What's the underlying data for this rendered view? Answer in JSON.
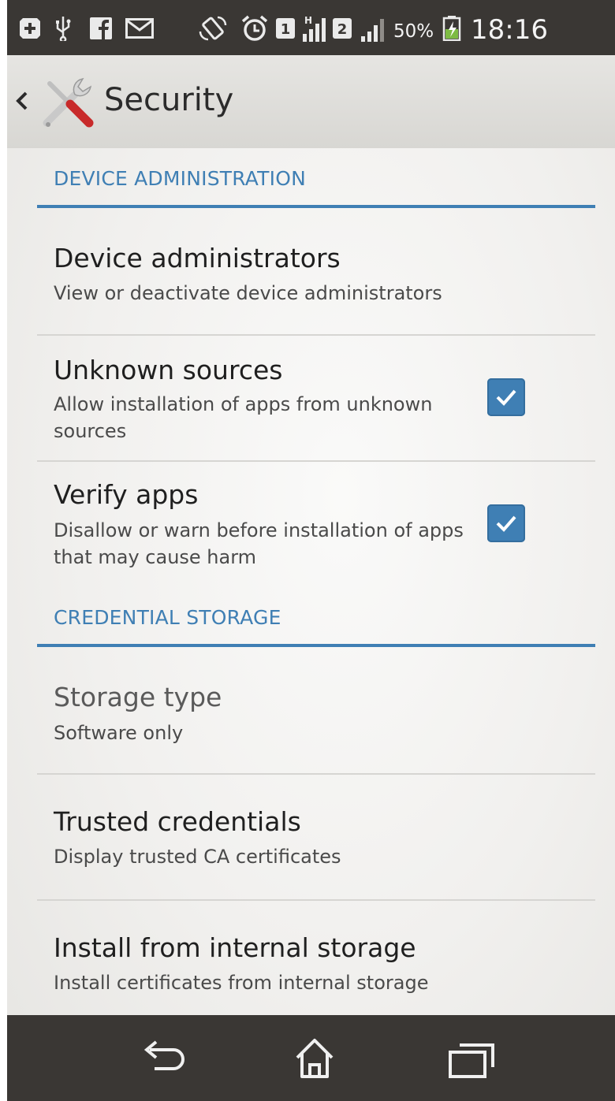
{
  "status_bar": {
    "battery_percent": "50%",
    "time": "18:16",
    "sim1_badge": "1",
    "sim2_badge": "2",
    "network_type": "H"
  },
  "action_bar": {
    "title": "Security"
  },
  "sections": {
    "device_admin": {
      "header": "DEVICE ADMINISTRATION"
    },
    "credential": {
      "header": "CREDENTIAL STORAGE"
    }
  },
  "items": {
    "device_administrators": {
      "title": "Device administrators",
      "subtitle": "View or deactivate device administrators"
    },
    "unknown_sources": {
      "title": "Unknown sources",
      "subtitle": "Allow installation of apps from unknown sources",
      "checked": true
    },
    "verify_apps": {
      "title": "Verify apps",
      "subtitle": "Disallow or warn before installation of apps that may cause harm",
      "checked": true
    },
    "storage_type": {
      "title": "Storage type",
      "subtitle": "Software only"
    },
    "trusted_credentials": {
      "title": "Trusted credentials",
      "subtitle": "Display trusted CA certificates"
    },
    "install_internal": {
      "title": "Install from internal storage",
      "subtitle": "Install certificates from internal storage"
    }
  },
  "colors": {
    "accent": "#3f7fb4",
    "bar_background": "#3a3734"
  },
  "icons": {
    "status": [
      "plus-square-icon",
      "usb-icon",
      "facebook-icon",
      "gmail-icon",
      "rotation-lock-icon",
      "alarm-icon",
      "sim1-icon",
      "signal-icon",
      "sim2-icon",
      "battery-charging-icon"
    ],
    "nav": [
      "back-icon",
      "home-icon",
      "recents-icon"
    ],
    "app": "tools-icon"
  }
}
